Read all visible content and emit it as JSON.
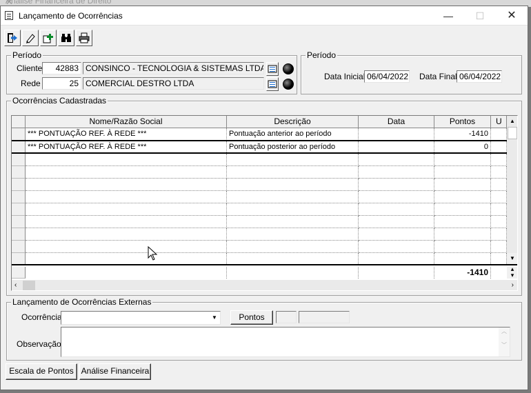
{
  "background_window": {
    "title": "Análise Financeira de Direito"
  },
  "window": {
    "title": "Lançamento de Ocorrências",
    "minimize": "—",
    "maximize": "☐",
    "close": "✕"
  },
  "toolbar": [
    "exit-door-icon",
    "pencil-icon",
    "add-record-icon",
    "binoculars-icon",
    "printer-icon"
  ],
  "periodo_left": {
    "legend": "Período",
    "cliente_label": "Cliente",
    "cliente_code": "42883",
    "cliente_name": "CONSINCO - TECNOLOGIA & SISTEMAS LTDA",
    "rede_label": "Rede",
    "rede_code": "25",
    "rede_name": "COMERCIAL DESTRO LTDA"
  },
  "periodo_right": {
    "legend": "Período",
    "data_inicial_label": "Data Inicial",
    "data_inicial": "06/04/2022",
    "data_final_label": "Data Final",
    "data_final": "06/04/2022"
  },
  "ocorrencias": {
    "legend": "Ocorrências Cadastradas",
    "columns": [
      "Nome/Razão Social",
      "Descrição",
      "Data",
      "Pontos",
      "U"
    ],
    "rows": [
      {
        "nome": "*** PONTUAÇÃO REF. À REDE ***",
        "descricao": "Pontuação anterior ao período",
        "data": "",
        "pontos": "-1410"
      },
      {
        "nome": "*** PONTUAÇÃO REF. À REDE ***",
        "descricao": "Pontuação posterior ao período",
        "data": "",
        "pontos": "0"
      }
    ],
    "total_pontos": "-1410"
  },
  "externas": {
    "legend": "Lançamento de Ocorrências Externas",
    "ocorrencia_label": "Ocorrência",
    "ocorrencia_value": "",
    "pontos_button": "Pontos",
    "observacao_label": "Observação"
  },
  "footer": {
    "escala_button": "Escala de Pontos",
    "analise_button": "Análise Financeira"
  }
}
